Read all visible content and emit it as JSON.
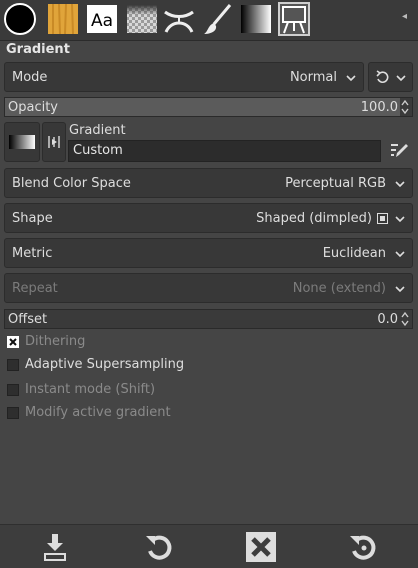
{
  "tabs": [
    {
      "icon": "colors-icon",
      "active": false
    },
    {
      "icon": "pattern-wood-icon",
      "active": false
    },
    {
      "icon": "fonts-icon",
      "active": false,
      "label": "Aa"
    },
    {
      "icon": "transparency-checker-icon",
      "active": false
    },
    {
      "icon": "warp-icon",
      "active": false
    },
    {
      "icon": "brush-icon",
      "active": false
    },
    {
      "icon": "gradient-swatch-icon",
      "active": false
    },
    {
      "icon": "tool-options-easel-icon",
      "active": true
    }
  ],
  "panel_title": "Gradient",
  "mode": {
    "label": "Mode",
    "value": "Normal"
  },
  "opacity": {
    "label": "Opacity",
    "value": "100.0",
    "fraction": 1.0
  },
  "gradient": {
    "label": "Gradient",
    "name": "Custom"
  },
  "blend_color_space": {
    "label": "Blend Color Space",
    "value": "Perceptual RGB"
  },
  "shape": {
    "label": "Shape",
    "value": "Shaped (dimpled)"
  },
  "metric": {
    "label": "Metric",
    "value": "Euclidean"
  },
  "repeat": {
    "label": "Repeat",
    "value": "None (extend)",
    "disabled": true
  },
  "offset": {
    "label": "Offset",
    "value": "0.0",
    "fraction": 0.0
  },
  "options": [
    {
      "label": "Dithering",
      "checked": true,
      "disabled": true
    },
    {
      "label": "Adaptive Supersampling",
      "checked": false,
      "disabled": false
    },
    {
      "label": "Instant mode  (Shift)",
      "checked": false,
      "disabled": true
    },
    {
      "label": "Modify active gradient",
      "checked": false,
      "disabled": true
    }
  ],
  "bottom_buttons": [
    "save-options-icon",
    "restore-icon",
    "delete-icon",
    "reset-icon"
  ],
  "colors": {
    "bg": "#454545",
    "row": "#383838",
    "text": "#dedede",
    "disabled": "#7b7b7b"
  }
}
